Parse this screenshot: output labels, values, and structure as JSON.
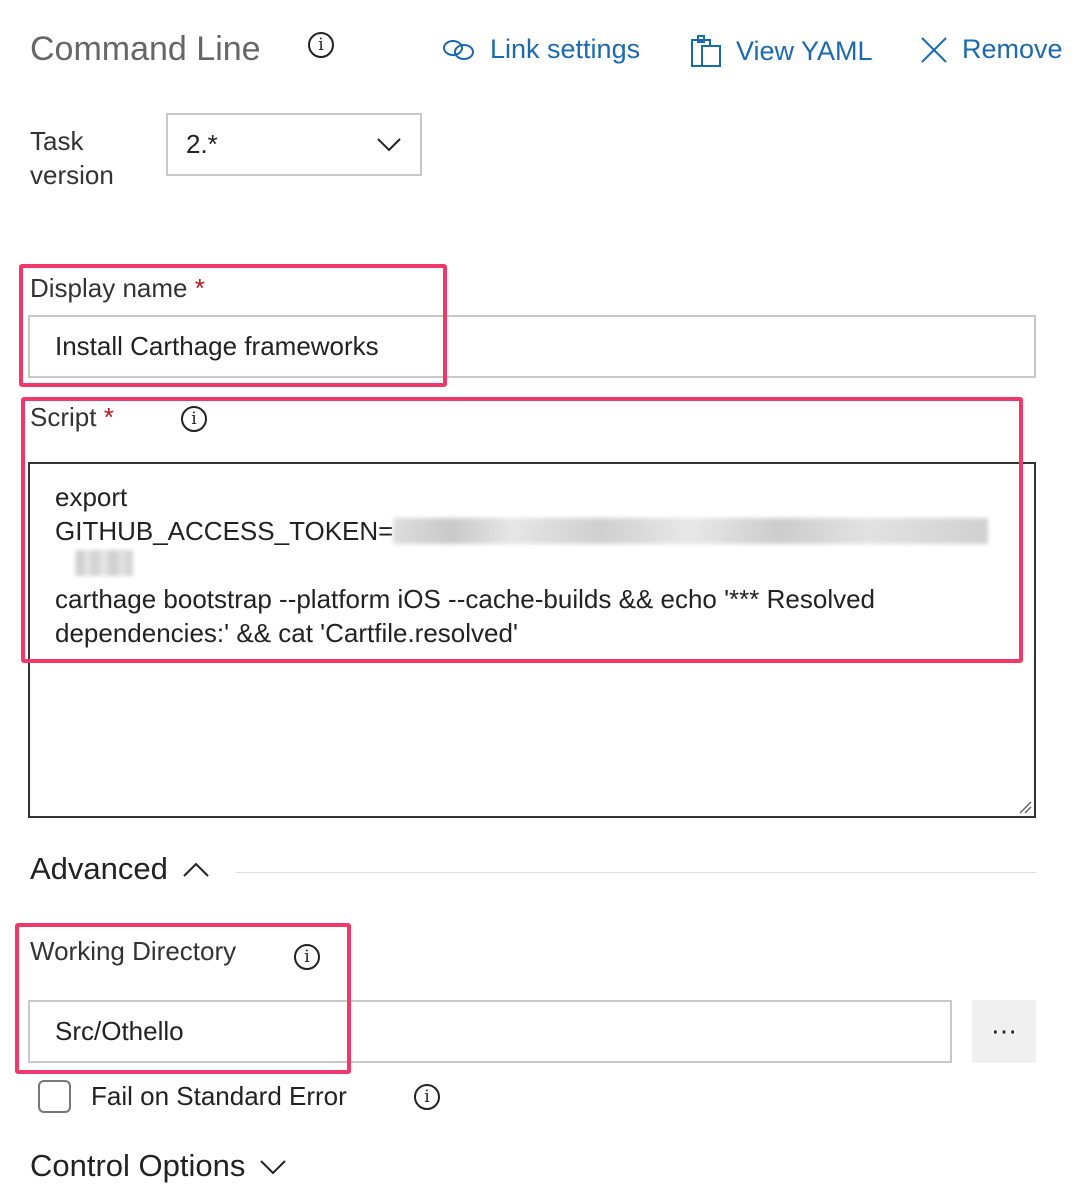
{
  "header": {
    "title": "Command Line",
    "link_settings": "Link settings",
    "view_yaml": "View YAML",
    "remove": "Remove"
  },
  "task_version": {
    "label_line1": "Task",
    "label_line2": "version",
    "value": "2.*"
  },
  "display_name": {
    "label": "Display name",
    "required": "*",
    "value": "Install Carthage frameworks"
  },
  "script": {
    "label": "Script",
    "required": "*",
    "line1": "export",
    "line2": "GITHUB_ACCESS_TOKEN=",
    "line3": "carthage bootstrap --platform iOS --cache-builds && echo '*** Resolved",
    "line4": "dependencies:' && cat 'Cartfile.resolved'"
  },
  "advanced": {
    "label": "Advanced"
  },
  "working_directory": {
    "label": "Working Directory",
    "value": "Src/Othello",
    "browse": "⋯"
  },
  "fail_on_stderr": {
    "label": "Fail on Standard Error",
    "checked": false
  },
  "control_options": {
    "label": "Control Options"
  },
  "colors": {
    "link": "#1b6ab0",
    "highlight": "#f0386b",
    "required": "#c0131a"
  }
}
